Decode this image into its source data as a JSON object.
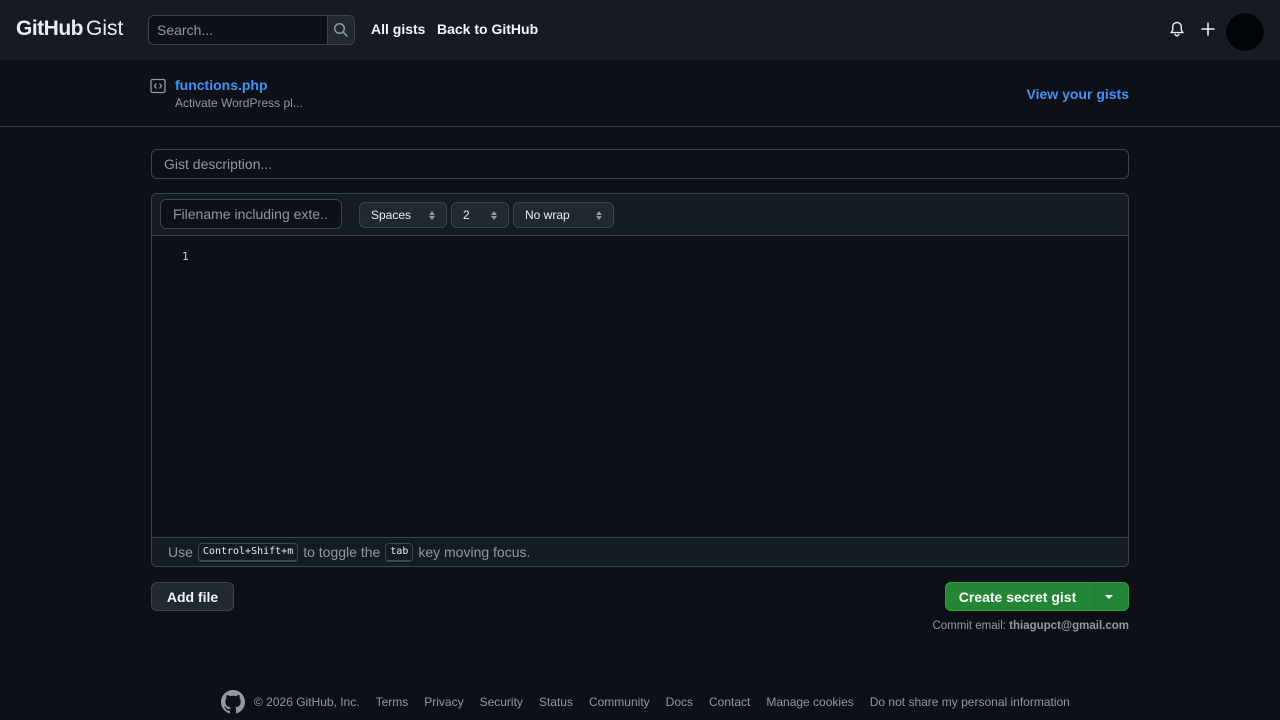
{
  "header": {
    "logo_primary": "GitHub",
    "logo_secondary": "Gist",
    "search_placeholder": "Search...",
    "nav": {
      "all_gists": "All gists",
      "back": "Back to GitHub"
    },
    "icons": {
      "search": "search-icon",
      "bell": "bell-icon",
      "plus": "plus-icon"
    }
  },
  "subheader": {
    "file_name": "functions.php",
    "file_desc": "Activate WordPress pl...",
    "view_gists": "View your gists"
  },
  "form": {
    "description_placeholder": "Gist description...",
    "filename_placeholder": "Filename including exte...",
    "indent_mode": "Spaces",
    "indent_size": "2",
    "wrap_mode": "No wrap",
    "line_number": "1",
    "hint_prefix": "Use",
    "hint_shortcut": "Control+Shift+m",
    "hint_middle": "to toggle the",
    "hint_key": "tab",
    "hint_suffix": "key moving focus."
  },
  "actions": {
    "add_file": "Add file",
    "create": "Create secret gist",
    "commit_email_label": "Commit email:",
    "commit_email": "thiagupct@gmail.com"
  },
  "footer": {
    "copyright": "© 2026 GitHub, Inc.",
    "links": [
      "Terms",
      "Privacy",
      "Security",
      "Status",
      "Community",
      "Docs",
      "Contact",
      "Manage cookies",
      "Do not share my personal information"
    ]
  },
  "colors": {
    "accent": "#4493f8",
    "primary_button": "#238636",
    "background": "#0d1117",
    "header_bg": "#161b22"
  }
}
